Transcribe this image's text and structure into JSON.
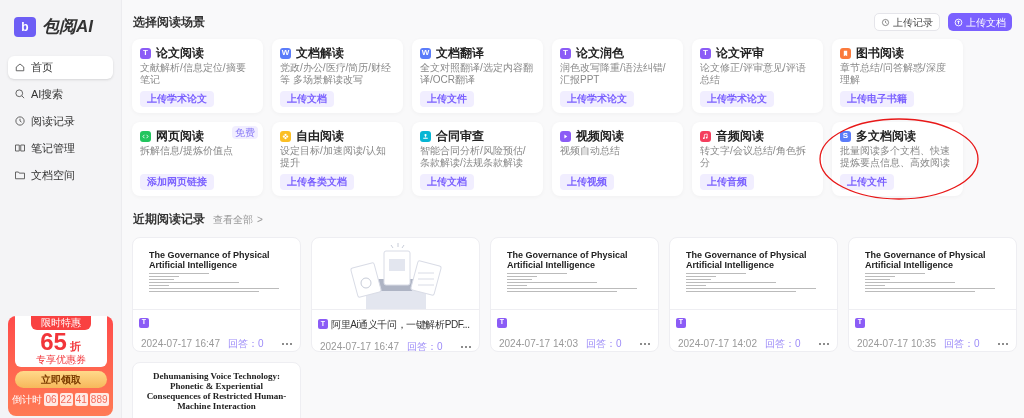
{
  "logo": {
    "text": "包阅AI",
    "badge": "b"
  },
  "sidebar": {
    "items": [
      {
        "label": "首页",
        "kind": "home",
        "selected": true
      },
      {
        "label": "AI搜索",
        "kind": "search",
        "selected": false
      },
      {
        "label": "阅读记录",
        "kind": "clock",
        "selected": false
      },
      {
        "label": "笔记管理",
        "kind": "book",
        "selected": false
      },
      {
        "label": "文档空间",
        "kind": "folder",
        "selected": false
      }
    ]
  },
  "promo": {
    "ribbon": "限时特惠",
    "discount": "65",
    "unit": "折",
    "caption": "专享优惠券",
    "button": "立即领取",
    "countdown_label": "倒计时",
    "countdown": [
      "06",
      "22",
      "41",
      "889"
    ]
  },
  "scenes": {
    "title": "选择阅读场景",
    "history_button": "上传记录",
    "upload_button": "上传文档",
    "cards": [
      {
        "title": "论文阅读",
        "desc": "文献解析/信息定位/摘要笔记",
        "action": "上传学术论文",
        "kind": "letter",
        "letter": "T",
        "color": "#8b5cf6",
        "circled": false
      },
      {
        "title": "文档解读",
        "desc": "党政/办公/医疗/简历/财经等 多场景解读改写",
        "action": "上传文档",
        "kind": "letter",
        "letter": "W",
        "color": "#5b7cfa",
        "circled": false
      },
      {
        "title": "文档翻译",
        "desc": "全文对照翻译/选定内容翻译/OCR翻译",
        "action": "上传文件",
        "kind": "letter",
        "letter": "W",
        "color": "#5b7cfa",
        "circled": false
      },
      {
        "title": "论文润色",
        "desc": "润色改写降重/语法纠错/汇报PPT",
        "action": "上传学术论文",
        "kind": "letter",
        "letter": "T",
        "color": "#8b5cf6",
        "circled": false
      },
      {
        "title": "论文评审",
        "desc": "论文修正/评审意见/评语总结",
        "action": "上传学术论文",
        "kind": "letter",
        "letter": "T",
        "color": "#8b5cf6",
        "circled": false
      },
      {
        "title": "图书阅读",
        "desc": "章节总结/问答解惑/深度理解",
        "action": "上传电子书籍",
        "kind": "bookmark",
        "color": "#fb7a3c",
        "circled": false
      },
      {
        "title": "网页阅读",
        "desc": "拆解信息/提炼价值点",
        "action": "添加网页链接",
        "kind": "code",
        "color": "#22c55e",
        "tag": "免费",
        "circled": false
      },
      {
        "title": "自由阅读",
        "desc": "设定目标/加速阅读/认知提升",
        "action": "上传各类文档",
        "kind": "flower",
        "color": "#fbbf24",
        "circled": false
      },
      {
        "title": "合同审查",
        "desc": "智能合同分析/风险预估/条款解读/法规条款解读",
        "action": "上传文档",
        "kind": "stamp",
        "color": "#06b6d4",
        "circled": false
      },
      {
        "title": "视频阅读",
        "desc": "视频自动总结",
        "action": "上传视频",
        "kind": "play",
        "color": "#8b5cf6",
        "circled": false
      },
      {
        "title": "音频阅读",
        "desc": "转文字/会议总结/角色拆分",
        "action": "上传音频",
        "kind": "music",
        "color": "#f43f5e",
        "circled": false
      },
      {
        "title": "多文档阅读",
        "desc": "批量阅读多个文档、快速提炼要点信息、高效阅读",
        "action": "上传文件",
        "kind": "letter",
        "letter": "S",
        "color": "#5b7cfa",
        "circled": true
      }
    ]
  },
  "recent": {
    "title": "近期阅读记录",
    "view_all": "查看全部",
    "view_all_arrow": ">",
    "cards": [
      {
        "kind": "paper",
        "paper_title": "The Governance of Physical Artificial Intelligence",
        "badge": "T",
        "date": "2024-07-17 16:47",
        "answers": "回答：0"
      },
      {
        "kind": "illustration",
        "badge": "T",
        "title": "阿里Ai通义千问，一键解析PDF...",
        "date": "2024-07-17 16:47",
        "answers": "回答：0"
      },
      {
        "kind": "paper",
        "paper_title": "The Governance of Physical Artificial Intelligence",
        "badge": "T",
        "date": "2024-07-17 14:03",
        "answers": "回答：0"
      },
      {
        "kind": "paper",
        "paper_title": "The Governance of Physical Artificial Intelligence",
        "badge": "T",
        "date": "2024-07-17 14:02",
        "answers": "回答：0"
      },
      {
        "kind": "paper",
        "paper_title": "The Governance of Physical Artificial Intelligence",
        "badge": "T",
        "date": "2024-07-17 10:35",
        "answers": "回答：0"
      },
      {
        "kind": "serif_paper",
        "paper_title": "Dehumanising Voice Technology: Phonetic & Experiential Consequences of Restricted Human-Machine Interaction"
      }
    ]
  }
}
